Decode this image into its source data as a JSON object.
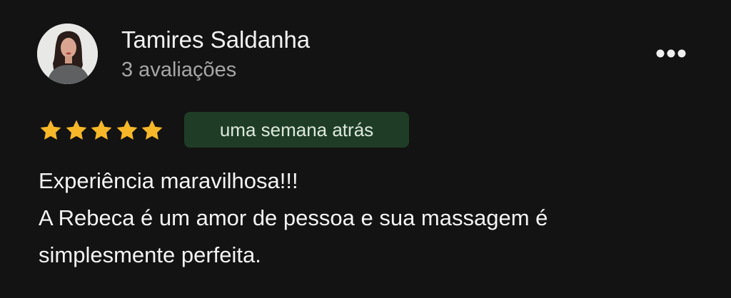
{
  "reviewer": {
    "name": "Tamires Saldanha",
    "review_count": "3 avaliações",
    "avatar_icon": "profile-photo"
  },
  "menu": {
    "icon": "more-horizontal-icon"
  },
  "rating": {
    "stars": 5,
    "max": 5,
    "star_color": "#f6b829"
  },
  "time_badge": {
    "label": "uma semana atrás",
    "background": "#1f3d26"
  },
  "review": {
    "lines": [
      "Experiência maravilhosa!!!",
      "A Rebeca é um amor de pessoa e sua massagem é",
      "simplesmente perfeita."
    ]
  }
}
